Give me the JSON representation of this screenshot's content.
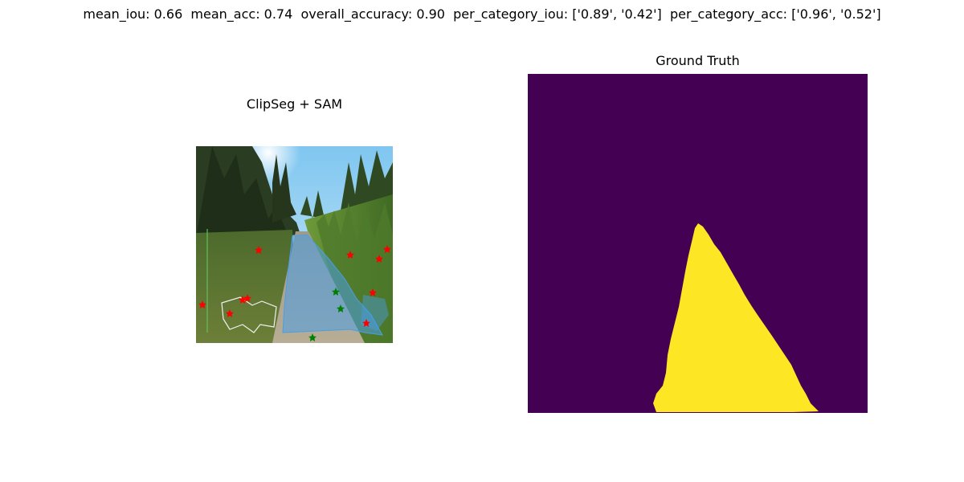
{
  "figure": {
    "suptitle": "mean_iou: 0.66  mean_acc: 0.74  overall_accuracy: 0.90  per_category_iou: ['0.89', '0.42']  per_category_acc: ['0.96', '0.52']"
  },
  "panels": {
    "left": {
      "title": "ClipSeg + SAM"
    },
    "right": {
      "title": "Ground Truth"
    }
  },
  "colors": {
    "gt_background": "#440154",
    "gt_foreground": "#fde725",
    "mask_overlay": "#4a9ee6",
    "negative_point": "#ff0000",
    "positive_point": "#008000"
  },
  "metrics": {
    "mean_iou": 0.66,
    "mean_acc": 0.74,
    "overall_accuracy": 0.9,
    "per_category_iou": [
      0.89,
      0.42
    ],
    "per_category_acc": [
      0.96,
      0.52
    ]
  }
}
